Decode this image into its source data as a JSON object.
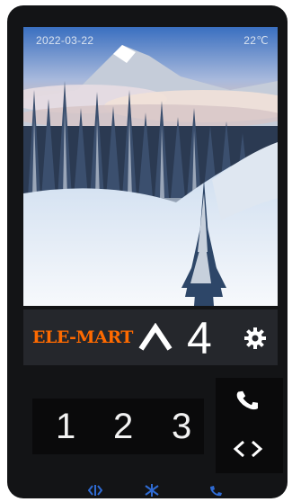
{
  "status": {
    "date": "2022-03-22",
    "temperature": "22℃"
  },
  "info_bar": {
    "brand": "ELE-MART",
    "direction_icon": "up-arrow-icon",
    "floor": "4",
    "settings_icon": "gear-icon"
  },
  "keypad": {
    "keys": [
      "1",
      "2",
      "3"
    ]
  },
  "right_panel": {
    "call_icon": "phone-icon",
    "door_icon": "open-close-arrows-icon"
  },
  "bottom_bar": {
    "icons": [
      "door-open-icon",
      "snowflake-icon",
      "phone-hangup-icon"
    ]
  },
  "colors": {
    "brand": "#ff6a00",
    "bottom_icon": "#2f6bd3",
    "panel": "#25272c"
  }
}
